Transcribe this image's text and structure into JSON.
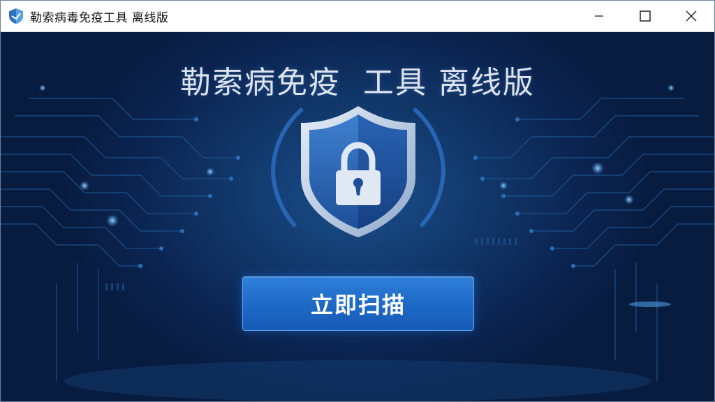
{
  "window": {
    "title": "勒索病毒免疫工具 离线版",
    "app_icon": "shield-app-icon",
    "controls": {
      "minimize": "minimize-icon",
      "maximize": "maximize-icon",
      "close": "close-icon"
    }
  },
  "main": {
    "title": "勒索病免疫  工具 离线版",
    "hero_icon": "shield-lock-icon",
    "scan_button_label": "立即扫描"
  },
  "colors": {
    "background_dark": "#0b2246",
    "background_glow": "#1a4f8c",
    "button": "#1d68c6",
    "circuit_line": "#1f5a96",
    "title_text": "#dbe3ee"
  }
}
